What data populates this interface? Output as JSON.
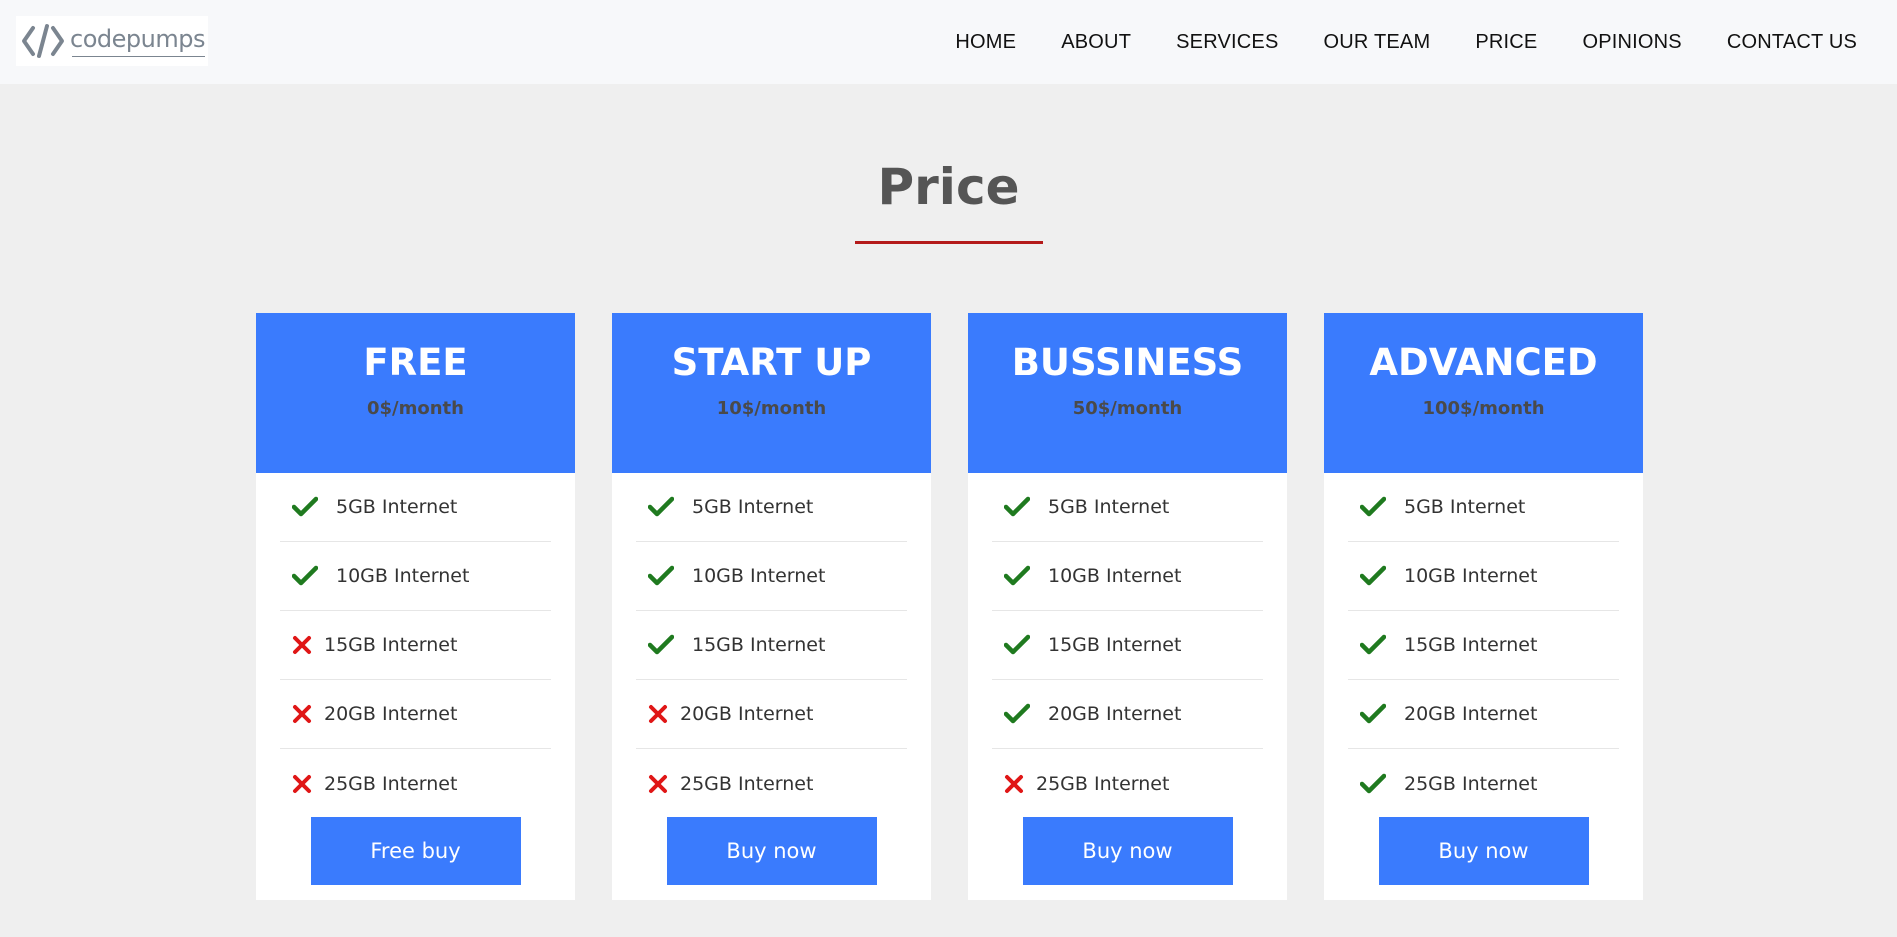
{
  "header": {
    "logo_text": "codepumps",
    "nav": [
      "HOME",
      "ABOUT",
      "SERVICES",
      "OUR TEAM",
      "PRICE",
      "OPINIONS",
      "CONTACT US"
    ]
  },
  "section": {
    "title": "Price"
  },
  "colors": {
    "accent": "#3a7bfd",
    "check": "#1f7a1f",
    "cross": "#e01616",
    "underline": "#b41a1a",
    "background": "#efefef"
  },
  "plans": [
    {
      "name": "FREE",
      "price": "0$/month",
      "button": "Free buy",
      "features": [
        {
          "label": "5GB Internet",
          "included": true
        },
        {
          "label": "10GB Internet",
          "included": true
        },
        {
          "label": "15GB Internet",
          "included": false
        },
        {
          "label": "20GB Internet",
          "included": false
        },
        {
          "label": "25GB Internet",
          "included": false
        }
      ]
    },
    {
      "name": "START UP",
      "price": "10$/month",
      "button": "Buy now",
      "features": [
        {
          "label": "5GB Internet",
          "included": true
        },
        {
          "label": "10GB Internet",
          "included": true
        },
        {
          "label": "15GB Internet",
          "included": true
        },
        {
          "label": "20GB Internet",
          "included": false
        },
        {
          "label": "25GB Internet",
          "included": false
        }
      ]
    },
    {
      "name": "BUSSINESS",
      "price": "50$/month",
      "button": "Buy now",
      "features": [
        {
          "label": "5GB Internet",
          "included": true
        },
        {
          "label": "10GB Internet",
          "included": true
        },
        {
          "label": "15GB Internet",
          "included": true
        },
        {
          "label": "20GB Internet",
          "included": true
        },
        {
          "label": "25GB Internet",
          "included": false
        }
      ]
    },
    {
      "name": "ADVANCED",
      "price": "100$/month",
      "button": "Buy now",
      "features": [
        {
          "label": "5GB Internet",
          "included": true
        },
        {
          "label": "10GB Internet",
          "included": true
        },
        {
          "label": "15GB Internet",
          "included": true
        },
        {
          "label": "20GB Internet",
          "included": true
        },
        {
          "label": "25GB Internet",
          "included": true
        }
      ]
    }
  ]
}
